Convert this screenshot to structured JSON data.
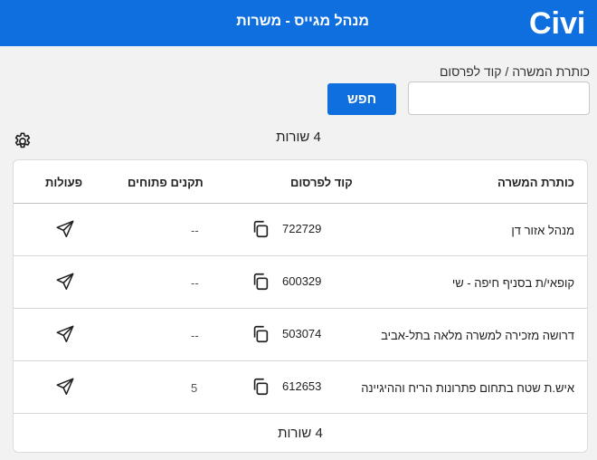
{
  "header": {
    "title": "מנהל מגייס - משרות",
    "logo_text": "Civi",
    "brand_color": "#0f6fde"
  },
  "search": {
    "label": "כותרת המשרה / קוד לפרסום",
    "value": "",
    "placeholder": "",
    "button_label": "חפש"
  },
  "results": {
    "count_top": "4 שורות",
    "count_bottom": "4 שורות"
  },
  "table": {
    "columns": {
      "title": "כותרת המשרה",
      "code": "קוד לפרסום",
      "open_slots": "תקנים פתוחים",
      "actions": "פעולות"
    },
    "rows": [
      {
        "title": "מנהל אזור דן",
        "code": "722729",
        "open_slots": "--"
      },
      {
        "title": "קופאי/ת בסניף חיפה - שי",
        "code": "600329",
        "open_slots": "--"
      },
      {
        "title": "דרושה מזכירה למשרה מלאה בתל-אביב",
        "code": "503074",
        "open_slots": "--"
      },
      {
        "title": "איש.ת שטח בתחום פתרונות הריח וההיגיינה",
        "code": "612653",
        "open_slots": "5"
      }
    ]
  },
  "icons": {
    "settings": "gear-icon",
    "copy": "copy-icon",
    "send": "send-icon"
  }
}
